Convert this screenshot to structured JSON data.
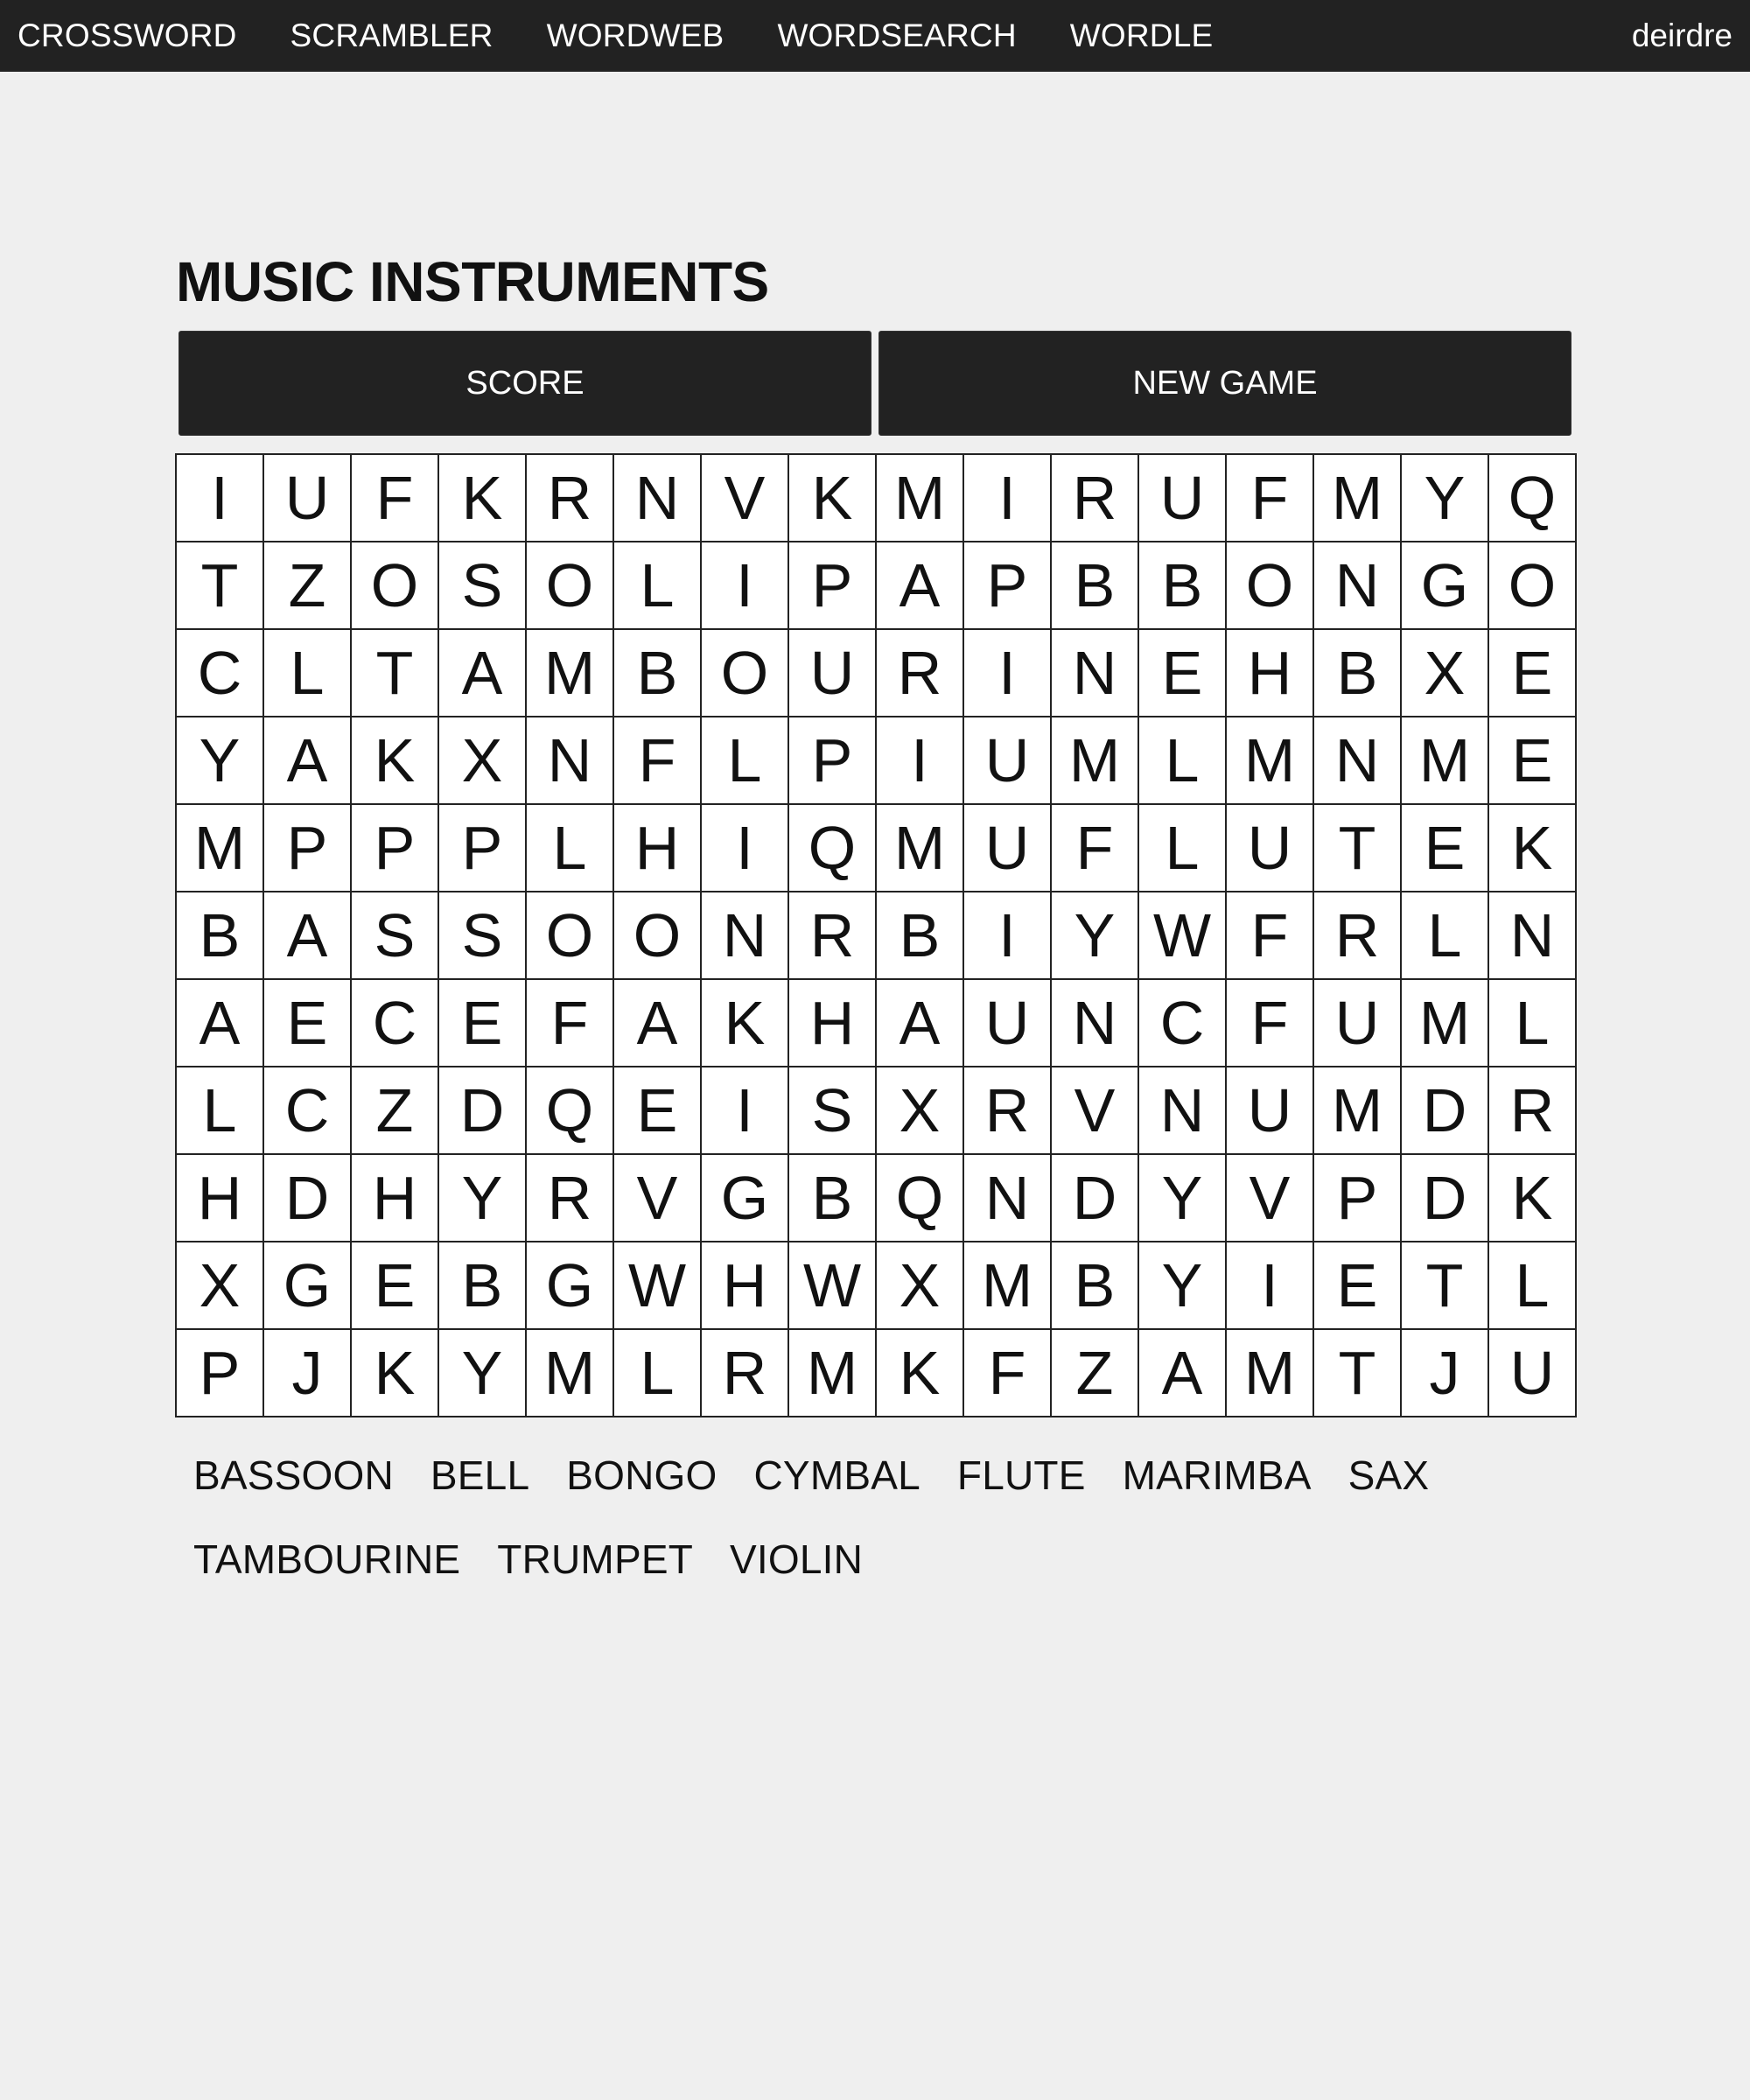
{
  "nav": {
    "links": [
      "CROSSWORD",
      "SCRAMBLER",
      "WORDWEB",
      "WORDSEARCH",
      "WORDLE"
    ],
    "user": "deirdre"
  },
  "game": {
    "title": "MUSIC INSTRUMENTS",
    "score_label": "SCORE",
    "new_game_label": "NEW GAME"
  },
  "grid": [
    [
      "I",
      "U",
      "F",
      "K",
      "R",
      "N",
      "V",
      "K",
      "M",
      "I",
      "R",
      "U",
      "F",
      "M",
      "Y",
      "Q"
    ],
    [
      "T",
      "Z",
      "O",
      "S",
      "O",
      "L",
      "I",
      "P",
      "A",
      "P",
      "B",
      "B",
      "O",
      "N",
      "G",
      "O"
    ],
    [
      "C",
      "L",
      "T",
      "A",
      "M",
      "B",
      "O",
      "U",
      "R",
      "I",
      "N",
      "E",
      "H",
      "B",
      "X",
      "E"
    ],
    [
      "Y",
      "A",
      "K",
      "X",
      "N",
      "F",
      "L",
      "P",
      "I",
      "U",
      "M",
      "L",
      "M",
      "N",
      "M",
      "E"
    ],
    [
      "M",
      "P",
      "P",
      "P",
      "L",
      "H",
      "I",
      "Q",
      "M",
      "U",
      "F",
      "L",
      "U",
      "T",
      "E",
      "K"
    ],
    [
      "B",
      "A",
      "S",
      "S",
      "O",
      "O",
      "N",
      "R",
      "B",
      "I",
      "Y",
      "W",
      "F",
      "R",
      "L",
      "N"
    ],
    [
      "A",
      "E",
      "C",
      "E",
      "F",
      "A",
      "K",
      "H",
      "A",
      "U",
      "N",
      "C",
      "F",
      "U",
      "M",
      "L"
    ],
    [
      "L",
      "C",
      "Z",
      "D",
      "Q",
      "E",
      "I",
      "S",
      "X",
      "R",
      "V",
      "N",
      "U",
      "M",
      "D",
      "R"
    ],
    [
      "H",
      "D",
      "H",
      "Y",
      "R",
      "V",
      "G",
      "B",
      "Q",
      "N",
      "D",
      "Y",
      "V",
      "P",
      "D",
      "K"
    ],
    [
      "X",
      "G",
      "E",
      "B",
      "G",
      "W",
      "H",
      "W",
      "X",
      "M",
      "B",
      "Y",
      "I",
      "E",
      "T",
      "L"
    ],
    [
      "P",
      "J",
      "K",
      "Y",
      "M",
      "L",
      "R",
      "M",
      "K",
      "F",
      "Z",
      "A",
      "M",
      "T",
      "J",
      "U"
    ]
  ],
  "words": [
    "BASSOON",
    "BELL",
    "BONGO",
    "CYMBAL",
    "FLUTE",
    "MARIMBA",
    "SAX",
    "TAMBOURINE",
    "TRUMPET",
    "VIOLIN"
  ]
}
